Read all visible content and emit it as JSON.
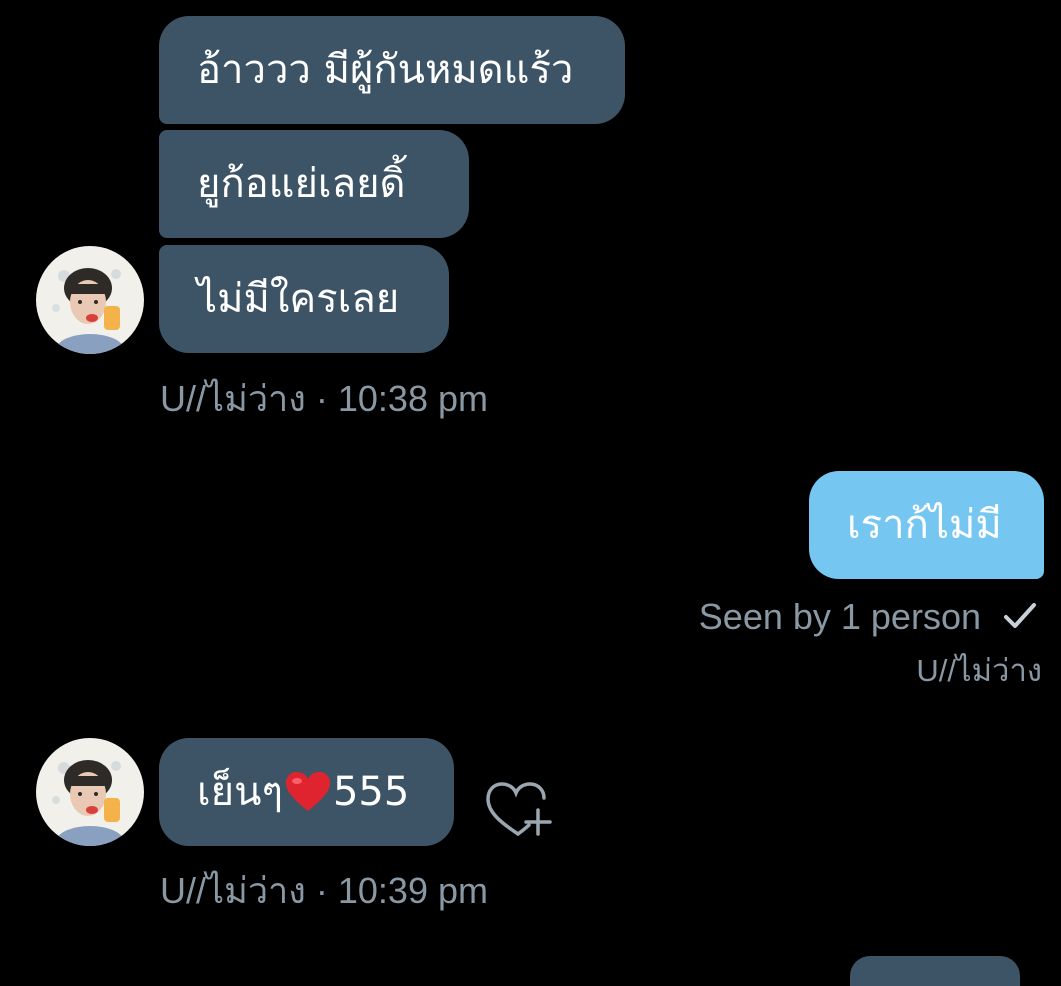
{
  "colors": {
    "background": "#000000",
    "incoming_bubble": "#3d5466",
    "outgoing_bubble": "#76c6f2",
    "meta_text": "#8a98a4"
  },
  "group1": {
    "messages": [
      "อ้าววว มีผู้กันหมดแร้ว",
      "ยูก้อแย่เลยดิ้",
      "ไม่มีใครเลย"
    ],
    "sender": "U//ไม่ว่าง",
    "separator": "·",
    "time": "10:38 pm",
    "avatar_icon": "avatar-photo"
  },
  "outgoing": {
    "message": "เราก้ไม่มี",
    "seen_text": "Seen by 1 person",
    "seen_icon": "checkmark-icon",
    "seen_by_name": "U//ไม่ว่าง"
  },
  "group2": {
    "message_prefix": "เย็นๆ",
    "message_emoji": "red-heart-emoji",
    "message_suffix": "555",
    "reaction_icon": "add-reaction-heart-icon",
    "sender": "U//ไม่ว่าง",
    "separator": "·",
    "time": "10:39 pm",
    "avatar_icon": "avatar-photo"
  }
}
